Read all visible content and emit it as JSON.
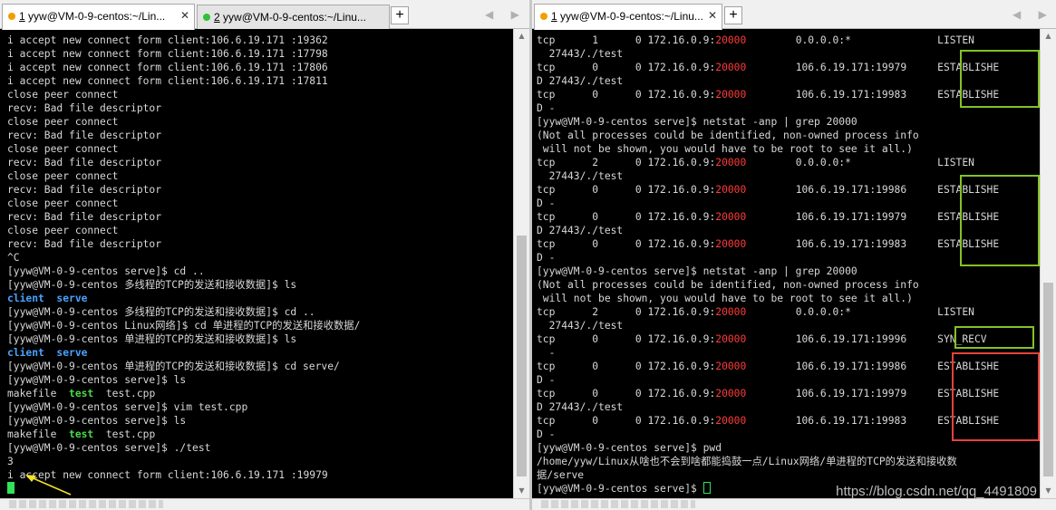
{
  "left_pane": {
    "tabs": [
      {
        "number": "1",
        "title": " yyw@VM-0-9-centos:~/Lin...",
        "dot_color": "#f29d00",
        "active": true
      },
      {
        "number": "2",
        "title": " yyw@VM-0-9-centos:~/Linu...",
        "dot_color": "#2ec13b",
        "active": false
      }
    ],
    "new_tab_label": "+",
    "nav_arrows": "◀ ▶",
    "close_glyph": "✕",
    "lines": [
      "i accept new connect form client:106.6.19.171 :19362",
      "i accept new connect form client:106.6.19.171 :17798",
      "i accept new connect form client:106.6.19.171 :17806",
      "i accept new connect form client:106.6.19.171 :17811",
      "close peer connect",
      "recv: Bad file descriptor",
      "close peer connect",
      "recv: Bad file descriptor",
      "close peer connect",
      "recv: Bad file descriptor",
      "close peer connect",
      "recv: Bad file descriptor",
      "close peer connect",
      "recv: Bad file descriptor",
      "close peer connect",
      "recv: Bad file descriptor",
      "^C",
      "[yyw@VM-0-9-centos serve]$ cd ..",
      "[yyw@VM-0-9-centos 多线程的TCP的发送和接收数据]$ ls",
      "",
      "[yyw@VM-0-9-centos 多线程的TCP的发送和接收数据]$ cd ..",
      "[yyw@VM-0-9-centos Linux网络]$ cd 单进程的TCP的发送和接收数据/",
      "[yyw@VM-0-9-centos 单进程的TCP的发送和接收数据]$ ls",
      "",
      "[yyw@VM-0-9-centos 单进程的TCP的发送和接收数据]$ cd serve/",
      "[yyw@VM-0-9-centos serve]$ ls",
      "",
      "[yyw@VM-0-9-centos serve]$ vim test.cpp",
      "[yyw@VM-0-9-centos serve]$ ls",
      "",
      "[yyw@VM-0-9-centos serve]$ ./test",
      "3",
      "i accept new connect form client:106.6.19.171 :19979"
    ],
    "ls_dirs": {
      "client": "client",
      "serve": "serve"
    },
    "ls_files": {
      "makefile": "makefile",
      "test_exec": "test",
      "test_cpp": "test.cpp"
    }
  },
  "right_pane": {
    "tabs": [
      {
        "number": "1",
        "title": " yyw@VM-0-9-centos:~/Linu...",
        "dot_color": "#f29d00",
        "active": true
      }
    ],
    "new_tab_label": "+",
    "nav_arrows": "◀ ▶",
    "close_glyph": "✕",
    "port": "20000",
    "rows": [
      {
        "kind": "sock",
        "proto": "tcp",
        "recvq": "1",
        "sendq": "0",
        "local_ip": "172.16.0.9:",
        "foreign": "0.0.0.0:*",
        "state": "LISTEN"
      },
      {
        "kind": "text",
        "text": "  27443/./test"
      },
      {
        "kind": "sock",
        "proto": "tcp",
        "recvq": "0",
        "sendq": "0",
        "local_ip": "172.16.0.9:",
        "foreign": "106.6.19.171:19979",
        "state": "ESTABLISHE"
      },
      {
        "kind": "text",
        "text": "D 27443/./test"
      },
      {
        "kind": "sock",
        "proto": "tcp",
        "recvq": "0",
        "sendq": "0",
        "local_ip": "172.16.0.9:",
        "foreign": "106.6.19.171:19983",
        "state": "ESTABLISHE"
      },
      {
        "kind": "text",
        "text": "D -"
      },
      {
        "kind": "text",
        "text": "[yyw@VM-0-9-centos serve]$ netstat -anp | grep 20000"
      },
      {
        "kind": "text",
        "text": "(Not all processes could be identified, non-owned process info"
      },
      {
        "kind": "text",
        "text": " will not be shown, you would have to be root to see it all.)"
      },
      {
        "kind": "sock",
        "proto": "tcp",
        "recvq": "2",
        "sendq": "0",
        "local_ip": "172.16.0.9:",
        "foreign": "0.0.0.0:*",
        "state": "LISTEN"
      },
      {
        "kind": "text",
        "text": "  27443/./test"
      },
      {
        "kind": "sock",
        "proto": "tcp",
        "recvq": "0",
        "sendq": "0",
        "local_ip": "172.16.0.9:",
        "foreign": "106.6.19.171:19986",
        "state": "ESTABLISHE"
      },
      {
        "kind": "text",
        "text": "D -"
      },
      {
        "kind": "sock",
        "proto": "tcp",
        "recvq": "0",
        "sendq": "0",
        "local_ip": "172.16.0.9:",
        "foreign": "106.6.19.171:19979",
        "state": "ESTABLISHE"
      },
      {
        "kind": "text",
        "text": "D 27443/./test"
      },
      {
        "kind": "sock",
        "proto": "tcp",
        "recvq": "0",
        "sendq": "0",
        "local_ip": "172.16.0.9:",
        "foreign": "106.6.19.171:19983",
        "state": "ESTABLISHE"
      },
      {
        "kind": "text",
        "text": "D -"
      },
      {
        "kind": "text",
        "text": "[yyw@VM-0-9-centos serve]$ netstat -anp | grep 20000"
      },
      {
        "kind": "text",
        "text": "(Not all processes could be identified, non-owned process info"
      },
      {
        "kind": "text",
        "text": " will not be shown, you would have to be root to see it all.)"
      },
      {
        "kind": "sock",
        "proto": "tcp",
        "recvq": "2",
        "sendq": "0",
        "local_ip": "172.16.0.9:",
        "foreign": "0.0.0.0:*",
        "state": "LISTEN"
      },
      {
        "kind": "text",
        "text": "  27443/./test"
      },
      {
        "kind": "sock",
        "proto": "tcp",
        "recvq": "0",
        "sendq": "0",
        "local_ip": "172.16.0.9:",
        "foreign": "106.6.19.171:19996",
        "state": "SYN_RECV"
      },
      {
        "kind": "text",
        "text": "  -"
      },
      {
        "kind": "sock",
        "proto": "tcp",
        "recvq": "0",
        "sendq": "0",
        "local_ip": "172.16.0.9:",
        "foreign": "106.6.19.171:19986",
        "state": "ESTABLISHE"
      },
      {
        "kind": "text",
        "text": "D -"
      },
      {
        "kind": "sock",
        "proto": "tcp",
        "recvq": "0",
        "sendq": "0",
        "local_ip": "172.16.0.9:",
        "foreign": "106.6.19.171:19979",
        "state": "ESTABLISHE"
      },
      {
        "kind": "text",
        "text": "D 27443/./test"
      },
      {
        "kind": "sock",
        "proto": "tcp",
        "recvq": "0",
        "sendq": "0",
        "local_ip": "172.16.0.9:",
        "foreign": "106.6.19.171:19983",
        "state": "ESTABLISHE"
      },
      {
        "kind": "text",
        "text": "D -"
      },
      {
        "kind": "text",
        "text": "[yyw@VM-0-9-centos serve]$ pwd"
      },
      {
        "kind": "text",
        "text": "/home/yyw/Linux从啥也不会到啥都能捣鼓一点/Linux网络/单进程的TCP的发送和接收数"
      },
      {
        "kind": "text",
        "text": "据/serve"
      },
      {
        "kind": "prompt",
        "text": "[yyw@VM-0-9-centos serve]$ "
      }
    ]
  },
  "watermark": "https://blog.csdn.net/qq_4491809",
  "colors": {
    "terminal_bg": "#000000",
    "terminal_fg": "#d8d8d8",
    "port_red": "#ff3b3b",
    "dir_blue": "#4aa3ff",
    "exec_green": "#4ad94a",
    "cursor_green": "#31e25a",
    "highlight_green": "#84c225",
    "highlight_red": "#e8413a",
    "annotation_arrow": "#f5e12a"
  }
}
